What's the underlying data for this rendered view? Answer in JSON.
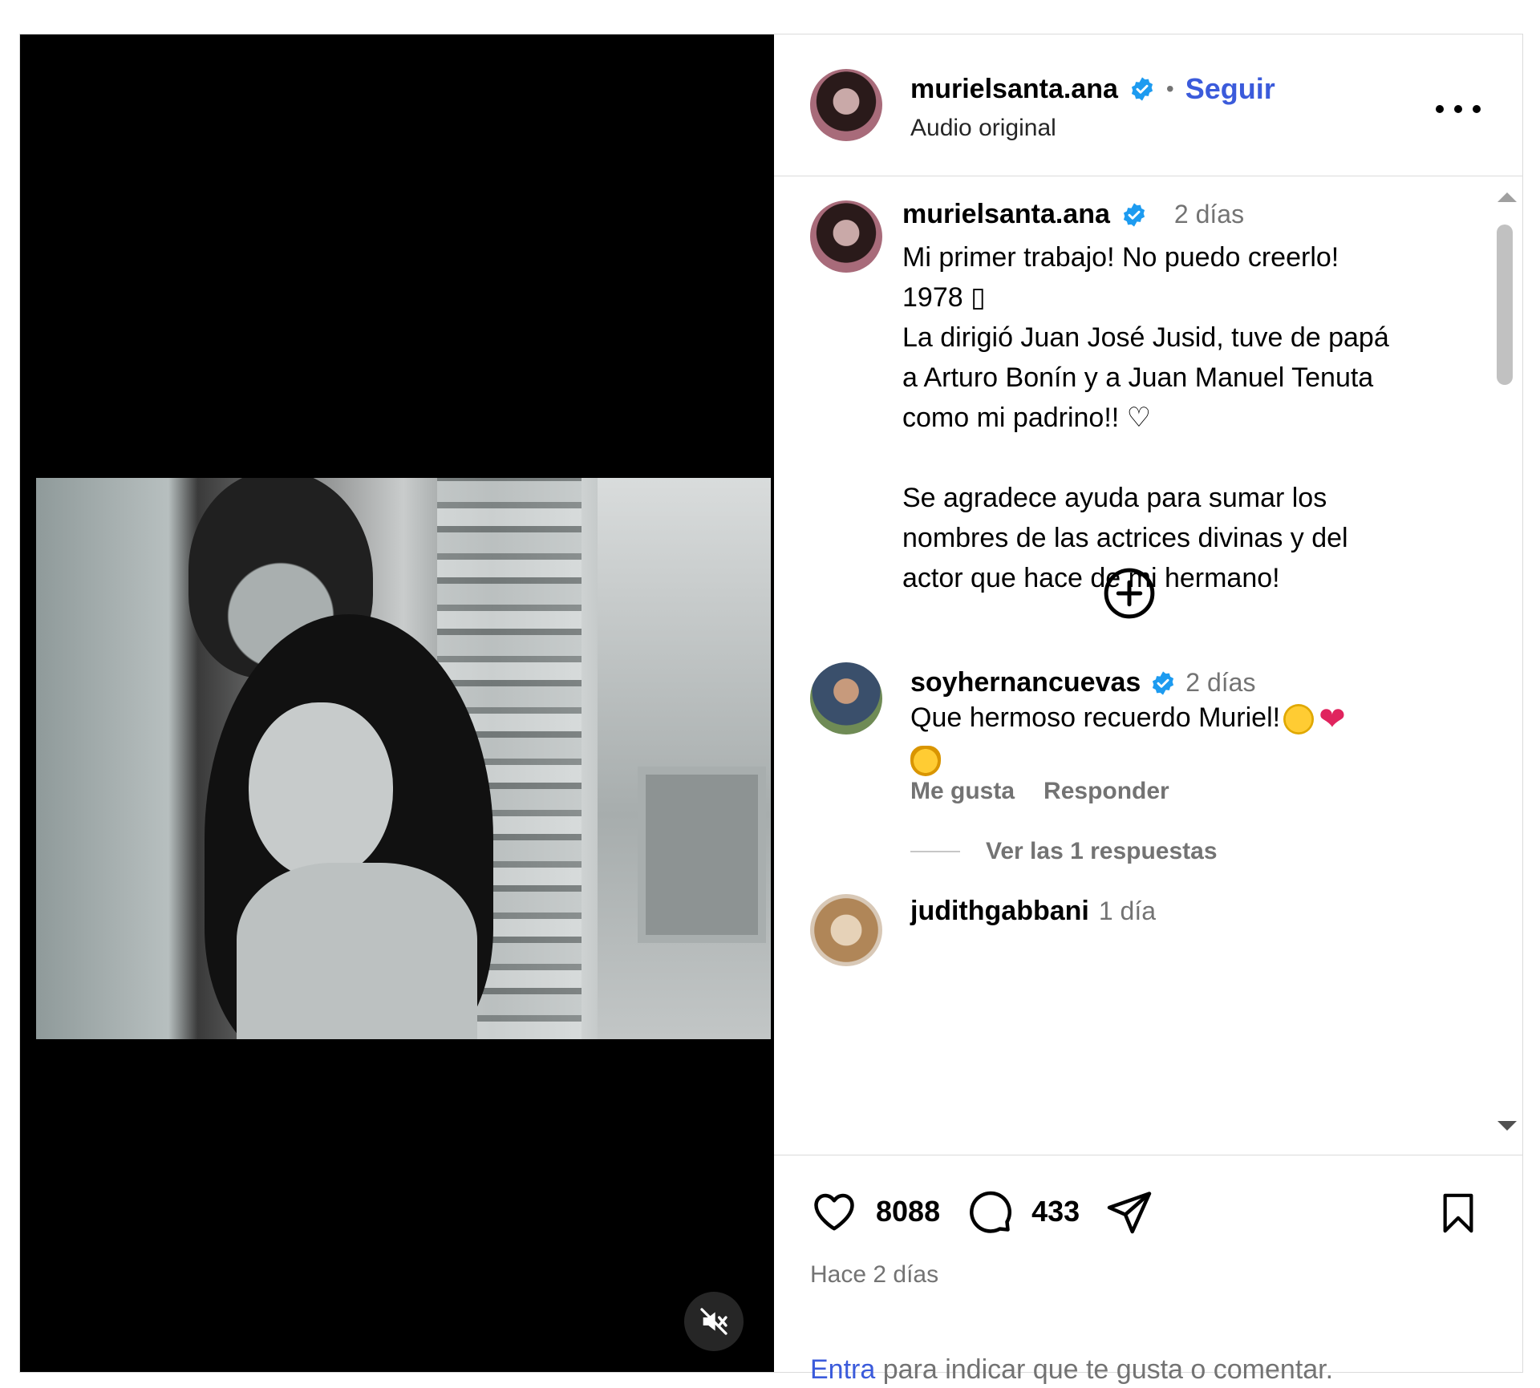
{
  "header": {
    "username": "murielsanta.ana",
    "separator": "•",
    "follow_label": "Seguir",
    "audio_label": "Audio original"
  },
  "caption": {
    "username": "murielsanta.ana",
    "time": "2 días",
    "text": "Mi primer trabajo! No puedo creerlo!\n1978 ▯\nLa dirigió Juan José Jusid, tuve de papá\na Arturo Bonín y a Juan Manuel Tenuta\ncomo mi padrino!! ♡\n\nSe agradece ayuda para sumar los\nnombres de las actrices divinas y del\nactor que hace de mi hermano!"
  },
  "comments": [
    {
      "username": "soyhernancuevas",
      "time": "2 días",
      "text": "Que hermoso recuerdo Muriel!",
      "like_label": "Me gusta",
      "reply_label": "Responder",
      "view_replies_label": "Ver las 1 respuestas"
    },
    {
      "username": "judithgabbani",
      "time": "1 día"
    }
  ],
  "stats": {
    "likes": "8088",
    "comments": "433",
    "posted_ago": "Hace 2 días"
  },
  "footer": {
    "login_link": "Entra",
    "login_text": " para indicar que te gusta o comentar."
  },
  "icons": {
    "verified": "verified-badge-icon",
    "more": "more-options-icon",
    "mute": "muted-speaker-icon",
    "plus": "load-more-plus-icon",
    "like": "heart-icon",
    "comment": "comment-bubble-icon",
    "share": "send-icon",
    "save": "bookmark-icon"
  },
  "colors": {
    "accent": "#3b5bdb",
    "verified": "#1d9bf0",
    "muted_text": "#737373",
    "border": "#dbdbdb"
  }
}
